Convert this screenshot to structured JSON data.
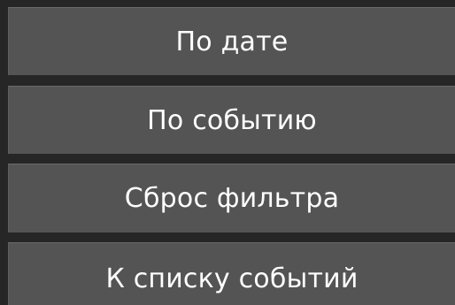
{
  "menu": {
    "buttons": [
      {
        "label": "По дате"
      },
      {
        "label": "По событию"
      },
      {
        "label": "Сброс фильтра"
      },
      {
        "label": "К списку событий"
      }
    ]
  }
}
